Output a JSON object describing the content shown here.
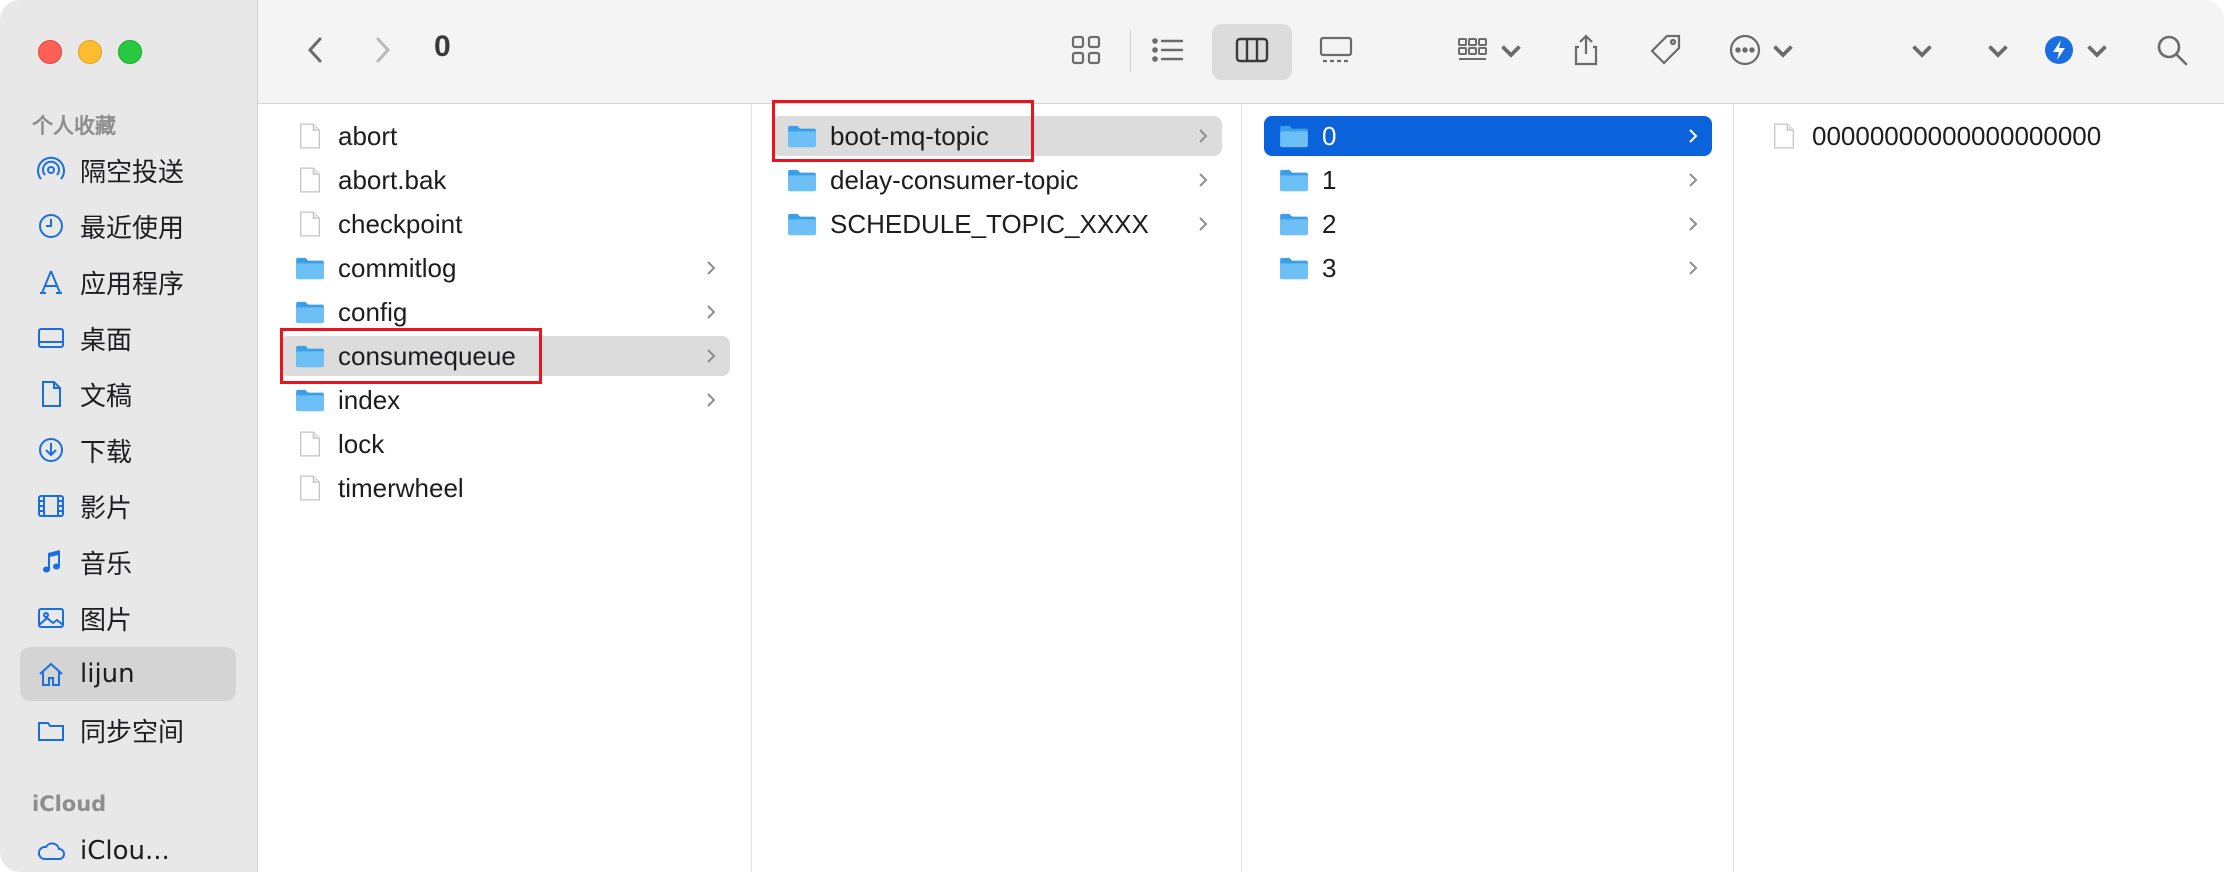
{
  "window": {
    "title": "0"
  },
  "sidebar": {
    "favorites_label": "个人收藏",
    "items": [
      {
        "label": "隔空投送",
        "icon": "airdrop-icon"
      },
      {
        "label": "最近使用",
        "icon": "clock-icon"
      },
      {
        "label": "应用程序",
        "icon": "applications-icon"
      },
      {
        "label": "桌面",
        "icon": "desktop-icon"
      },
      {
        "label": "文稿",
        "icon": "document-icon"
      },
      {
        "label": "下载",
        "icon": "download-icon"
      },
      {
        "label": "影片",
        "icon": "film-icon"
      },
      {
        "label": "音乐",
        "icon": "music-icon"
      },
      {
        "label": "图片",
        "icon": "photo-icon"
      },
      {
        "label": "lijun",
        "icon": "home-icon",
        "active": true
      },
      {
        "label": "同步空间",
        "icon": "folder-icon"
      }
    ],
    "icloud_label": "iCloud",
    "icloud_items": [
      {
        "label": "iClou...",
        "icon": "icloud-icon"
      }
    ]
  },
  "columns": [
    {
      "items": [
        {
          "name": "abort",
          "type": "file"
        },
        {
          "name": "abort.bak",
          "type": "file"
        },
        {
          "name": "checkpoint",
          "type": "file"
        },
        {
          "name": "commitlog",
          "type": "folder"
        },
        {
          "name": "config",
          "type": "folder"
        },
        {
          "name": "consumequeue",
          "type": "folder",
          "selected": true
        },
        {
          "name": "index",
          "type": "folder"
        },
        {
          "name": "lock",
          "type": "file"
        },
        {
          "name": "timerwheel",
          "type": "file"
        }
      ]
    },
    {
      "items": [
        {
          "name": "boot-mq-topic",
          "type": "folder",
          "selected": true
        },
        {
          "name": "delay-consumer-topic",
          "type": "folder"
        },
        {
          "name": "SCHEDULE_TOPIC_XXXX",
          "type": "folder"
        }
      ]
    },
    {
      "items": [
        {
          "name": "0",
          "type": "folder",
          "selected": true,
          "active": true
        },
        {
          "name": "1",
          "type": "folder"
        },
        {
          "name": "2",
          "type": "folder"
        },
        {
          "name": "3",
          "type": "folder"
        }
      ]
    },
    {
      "items": [
        {
          "name": "00000000000000000000",
          "type": "file"
        }
      ]
    }
  ],
  "colors": {
    "accent": "#0a63db",
    "highlight_box": "#e8141e",
    "folder": "#5ab4f0"
  }
}
